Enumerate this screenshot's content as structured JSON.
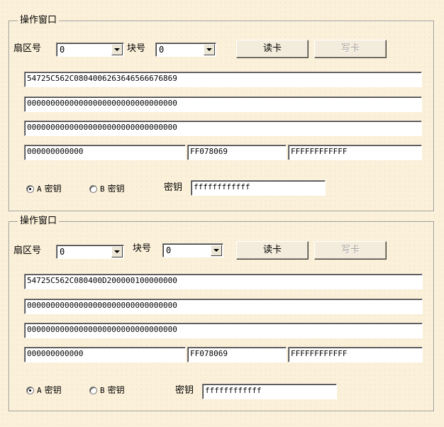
{
  "panels": [
    {
      "title": "操作窗口",
      "sector_label": "扇区号",
      "sector_value": "0",
      "block_label": "块号",
      "block_value": "0",
      "read_button": "读卡",
      "write_button": "写卡",
      "data_rows": [
        "54725C562C0804006263646566676869",
        "00000000000000000000000000000000",
        "00000000000000000000000000000000"
      ],
      "key_a_field": "000000000000",
      "access_bits_field": "FF078069",
      "key_b_field": "FFFFFFFFFFFF",
      "radio_a_prefix": "A",
      "radio_a_label": "密钥",
      "radio_b_prefix": "B",
      "radio_b_label": "密钥",
      "key_label": "密钥",
      "key_value": "ffffffffffff"
    },
    {
      "title": "操作窗口",
      "sector_label": "扇区号",
      "sector_value": "0",
      "block_label": "块号",
      "block_value": "0",
      "read_button": "读卡",
      "write_button": "写卡",
      "data_rows": [
        "54725C562C080400D200000100000000",
        "00000000000000000000000000000000",
        "00000000000000000000000000000000"
      ],
      "key_a_field": "000000000000",
      "access_bits_field": "FF078069",
      "key_b_field": "FFFFFFFFFFFF",
      "radio_a_prefix": "A",
      "radio_a_label": "密钥",
      "radio_b_prefix": "B",
      "radio_b_label": "密钥",
      "key_label": "密钥",
      "key_value": "ffffffffffff"
    }
  ]
}
